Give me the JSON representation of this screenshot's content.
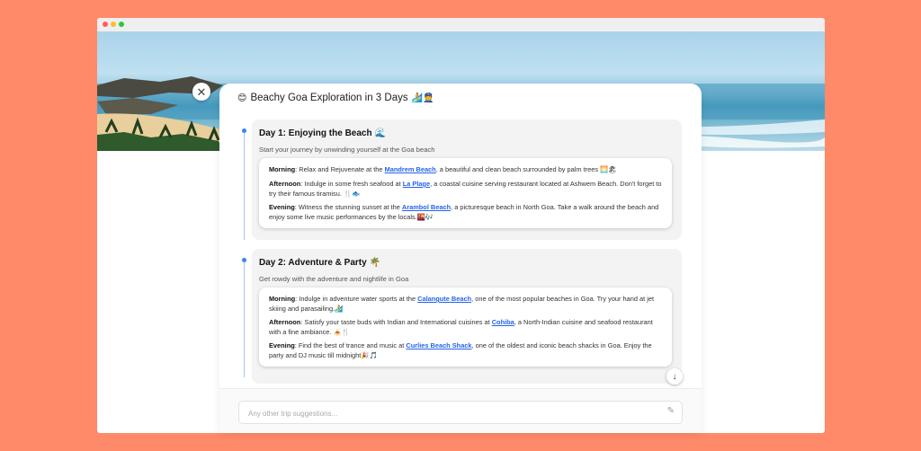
{
  "panel": {
    "title": "Beachy Goa Exploration in 3 Days",
    "title_emoji_leading": "😊",
    "title_emoji_trailing": "🏄👮"
  },
  "days": [
    {
      "title": "Day 1: Enjoying the Beach",
      "title_emoji": "🌊",
      "subtitle": "Start your journey by unwinding yourself at the Goa beach",
      "entries": [
        {
          "label": "Morning",
          "pre": ": Relax and Rejuvenate at the ",
          "link": "Mandrem Beach",
          "post": ", a beautiful and clean beach surrounded by palm trees 🌅🏖"
        },
        {
          "label": "Afternoon",
          "pre": ": Indulge in some fresh seafood at ",
          "link": "La Plage",
          "post": ", a coastal cuisine serving restaurant located at Ashwem Beach. Don't forget to try their famous tiramisu. 🍴🐟"
        },
        {
          "label": "Evening",
          "pre": ": Witness the stunning sunset at the ",
          "link": "Arambol Beach",
          "post": ", a picturesque beach in North Goa. Take a walk around the beach and enjoy some live music performances by the locals.🌇🎶"
        }
      ]
    },
    {
      "title": "Day 2: Adventure & Party",
      "title_emoji": "🌴",
      "subtitle": "Get rowdy with the adventure and nightlife in Goa",
      "entries": [
        {
          "label": "Morning",
          "pre": ": Indulge in adventure water sports at the ",
          "link": "Calangute Beach",
          "post": ", one of the most popular beaches in Goa. Try your hand at jet skiing and parasailing.🏄"
        },
        {
          "label": "Afternoon",
          "pre": ": Satisfy your taste buds with Indian and International cuisines at ",
          "link": "Cohiba",
          "post": ", a North-Indian cuisine and seafood restaurant with a fine ambiance. 🍝🍴"
        },
        {
          "label": "Evening",
          "pre": ": Find the best of trance and music at ",
          "link": "Curlies Beach Shack",
          "post": ", one of the oldest and iconic beach shacks in Goa. Enjoy the party and DJ music till midnight🎉🎵"
        }
      ]
    }
  ],
  "input": {
    "placeholder": "Any other trip suggestions..."
  },
  "icons": {
    "close": "close-icon",
    "scroll": "arrow-down-icon",
    "pencil": "pencil-icon"
  },
  "colors": {
    "background": "#FF8A6A",
    "link": "#2563eb",
    "timeline": "#3b82f6"
  }
}
